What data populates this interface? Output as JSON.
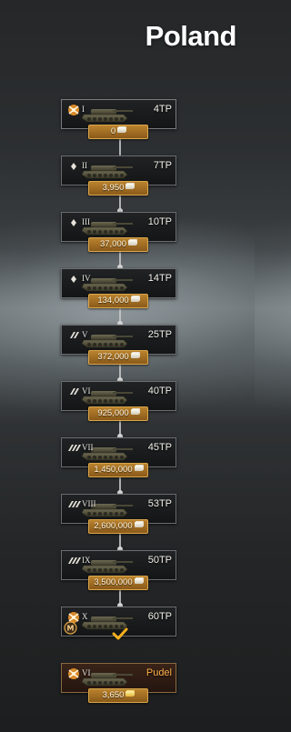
{
  "title": "Poland",
  "tanks": [
    {
      "tier": "I",
      "name": "4TP",
      "price": "0",
      "currency": "xp",
      "type": "researched",
      "tier_icon": "crossed-swords-emblem-icon"
    },
    {
      "tier": "II",
      "name": "7TP",
      "price": "3,950",
      "currency": "xp",
      "type": "normal",
      "tier_icon": "light-tank-icon"
    },
    {
      "tier": "III",
      "name": "10TP",
      "price": "37,000",
      "currency": "xp",
      "type": "normal",
      "tier_icon": "light-tank-icon"
    },
    {
      "tier": "IV",
      "name": "14TP",
      "price": "134,000",
      "currency": "xp",
      "type": "normal",
      "tier_icon": "light-tank-icon"
    },
    {
      "tier": "V",
      "name": "25TP",
      "price": "372,000",
      "currency": "xp",
      "type": "normal",
      "tier_icon": "medium-tank-icon"
    },
    {
      "tier": "VI",
      "name": "40TP",
      "price": "925,000",
      "currency": "xp",
      "type": "normal",
      "tier_icon": "medium-tank-icon"
    },
    {
      "tier": "VII",
      "name": "45TP",
      "price": "1,450,000",
      "currency": "xp",
      "type": "normal",
      "tier_icon": "heavy-tank-icon"
    },
    {
      "tier": "VIII",
      "name": "53TP",
      "price": "2,600,000",
      "currency": "xp",
      "type": "normal",
      "tier_icon": "heavy-tank-icon"
    },
    {
      "tier": "IX",
      "name": "50TP",
      "price": "3,500,000",
      "currency": "xp",
      "type": "normal",
      "tier_icon": "heavy-tank-icon"
    },
    {
      "tier": "X",
      "name": "60TP",
      "price": "",
      "currency": "",
      "type": "mastered",
      "tier_icon": "crossed-swords-emblem-icon"
    },
    {
      "tier": "VI",
      "name": "Pudel",
      "price": "3,650",
      "currency": "credits",
      "type": "premium",
      "tier_icon": "crossed-swords-emblem-icon"
    }
  ],
  "colors": {
    "price_badge": "#b9822e",
    "premium_name": "#ffb14a",
    "checkmark": "#f5b01c"
  }
}
